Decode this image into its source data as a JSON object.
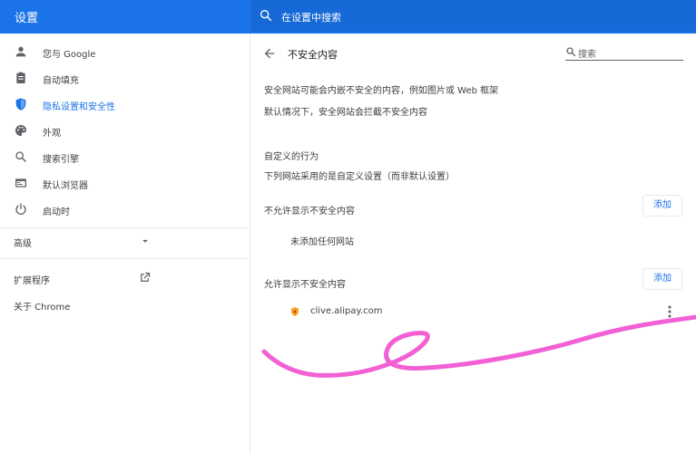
{
  "header": {
    "title": "设置",
    "search_placeholder": "在设置中搜索"
  },
  "sidebar": {
    "items": [
      {
        "label": "您与 Google",
        "icon": "person-icon"
      },
      {
        "label": "自动填充",
        "icon": "clipboard-icon"
      },
      {
        "label": "隐私设置和安全性",
        "icon": "shield-icon",
        "active": true
      },
      {
        "label": "外观",
        "icon": "palette-icon"
      },
      {
        "label": "搜索引擎",
        "icon": "search-icon"
      },
      {
        "label": "默认浏览器",
        "icon": "browser-icon"
      },
      {
        "label": "启动时",
        "icon": "power-icon"
      }
    ],
    "advanced_label": "高级",
    "extensions_label": "扩展程序",
    "about_label": "关于 Chrome"
  },
  "main": {
    "page_title": "不安全内容",
    "search_placeholder": "搜索",
    "desc1": "安全网站可能会内嵌不安全的内容，例如图片或 Web 框架",
    "desc2": "默认情况下，安全网站会拦截不安全内容",
    "custom_heading": "自定义的行为",
    "custom_desc": "下列网站采用的是自定义设置（而非默认设置）",
    "block_section": {
      "title": "不允许显示不安全内容",
      "add_label": "添加",
      "empty_text": "未添加任何网站"
    },
    "allow_section": {
      "title": "允许显示不安全内容",
      "add_label": "添加",
      "sites": [
        {
          "name": "clive.alipay.com"
        }
      ]
    }
  },
  "colors": {
    "accent": "#1a73e8",
    "header_bg": "#1a73e8",
    "scribble": "#f050d0"
  }
}
